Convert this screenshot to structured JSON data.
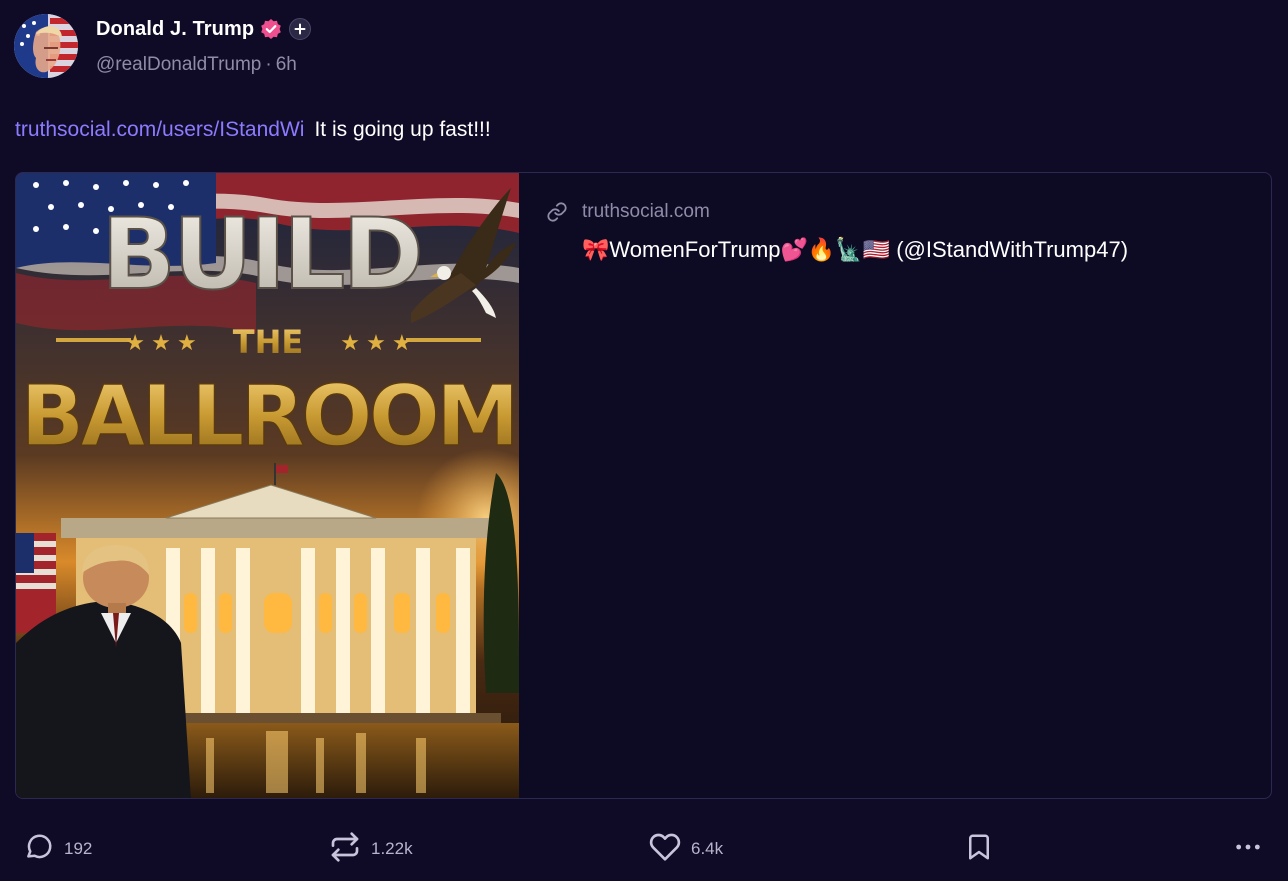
{
  "author": {
    "display_name": "Donald J. Trump",
    "handle": "@realDonaldTrump",
    "time_ago": "6h"
  },
  "post": {
    "link_text": "truthsocial.com/users/IStandWi",
    "message": "It is going up fast!!!"
  },
  "card": {
    "image_text": {
      "line1": "BUILD",
      "line2": "THE",
      "line3": "BALLROOM"
    },
    "domain": "truthsocial.com",
    "title": "🎀WomenForTrump💕🔥🗽🇺🇸 (@IStandWithTrump47)"
  },
  "actions": {
    "replies": "192",
    "reposts": "1.22k",
    "likes": "6.4k"
  },
  "colors": {
    "background": "#0f0b27",
    "link": "#8b7bff",
    "verified_badge": "#ef4f8f",
    "muted_text": "#8f8ba8"
  },
  "icons": [
    "verified-icon",
    "plus-icon",
    "link-icon",
    "reply-icon",
    "repost-icon",
    "like-icon",
    "bookmark-icon",
    "more-icon"
  ]
}
